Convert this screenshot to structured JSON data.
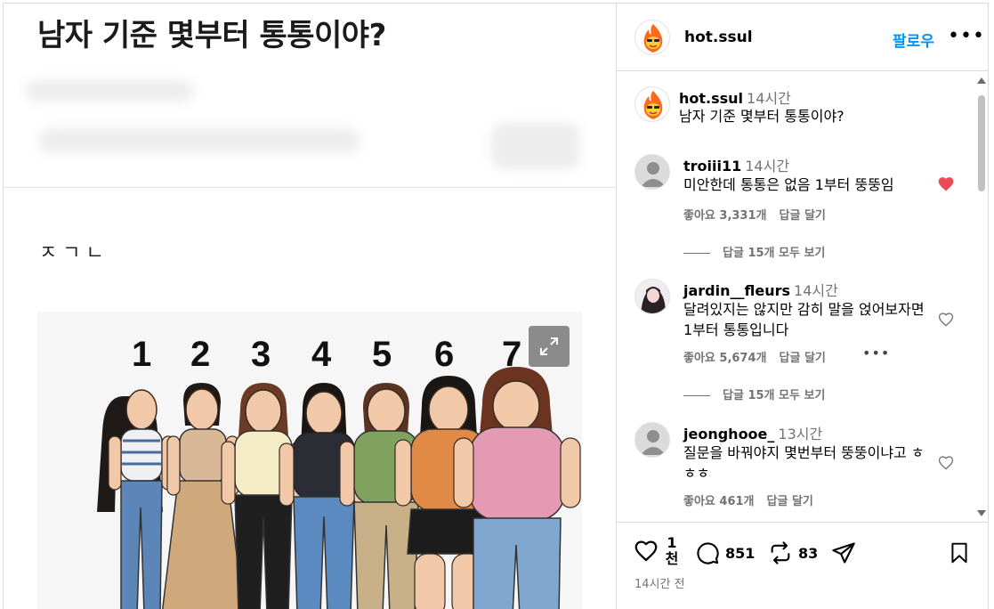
{
  "post": {
    "title": "남자 기준 몇부터 통통이야?",
    "body": "ㅈㄱㄴ",
    "figure_numbers": [
      "1",
      "2",
      "3",
      "4",
      "5",
      "6",
      "7"
    ]
  },
  "header": {
    "username": "hot.ssul",
    "follow_label": "팔로우",
    "more_label": "•••",
    "avatar_icon": "fire-face-avatar-icon"
  },
  "caption": {
    "username": "hot.ssul",
    "time": "14시간",
    "text": "남자 기준 몇부터 통통이야?"
  },
  "comments": [
    {
      "username": "troiii11",
      "time": "14시간",
      "text": "미안한데 통통은 없음 1부터 뚱뚱임",
      "likes_label": "좋아요 3,331개",
      "reply_label": "답글 달기",
      "view_replies": "답글 15개 모두 보기",
      "liked": true
    },
    {
      "username": "jardin__fleurs",
      "time": "14시간",
      "text": "달려있지는 않지만 감히 말을 얹어보자면 1부터 통통입니다",
      "likes_label": "좋아요 5,674개",
      "reply_label": "답글 달기",
      "more_label": "•••",
      "view_replies": "답글 15개 모두 보기",
      "liked": false
    },
    {
      "username": "jeonghooe_",
      "time": "13시간",
      "text": "질문을 바꿔야지 몇번부터 뚱뚱이냐고 ㅎㅎㅎ",
      "likes_label": "좋아요 461개",
      "reply_label": "답글 달기",
      "liked": false
    }
  ],
  "actions": {
    "like_count": "1천",
    "comment_count": "851",
    "repost_count": "83",
    "posted_time": "14시간 전"
  },
  "colors": {
    "accent": "#0095f6",
    "liked_heart": "#ed4956",
    "muted_text": "#737373"
  }
}
